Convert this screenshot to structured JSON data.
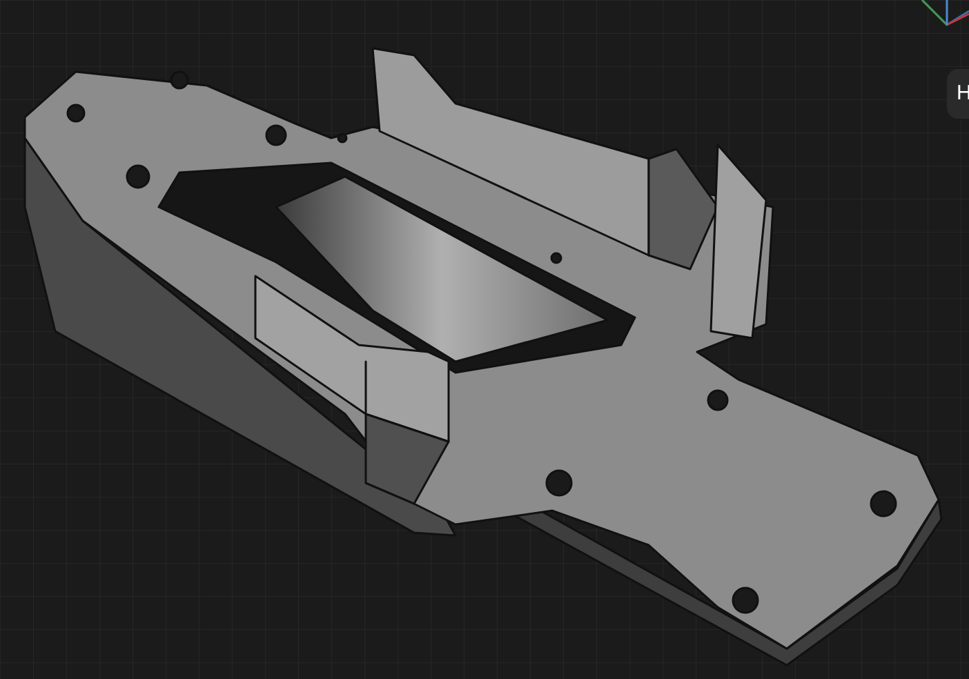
{
  "viewport": {
    "side_button": {
      "label": "H"
    }
  }
}
